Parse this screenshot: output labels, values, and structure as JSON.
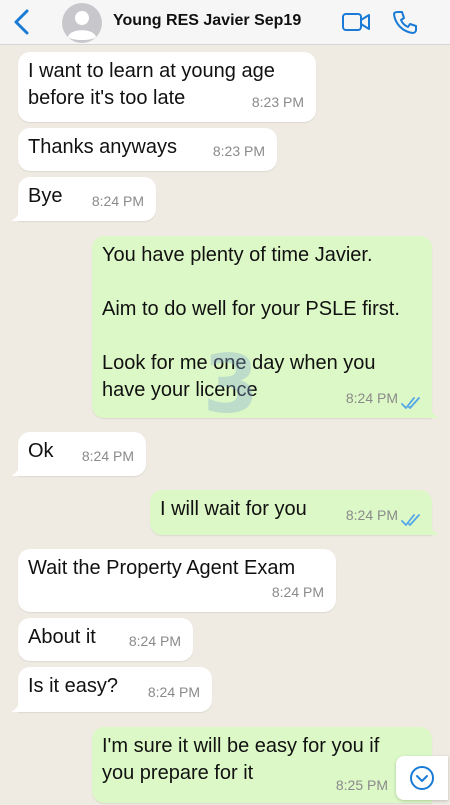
{
  "header": {
    "contact_name": "Young RES Javier Sep19",
    "icons": [
      "back-chevron",
      "avatar",
      "video-call",
      "phone-call"
    ]
  },
  "messages": [
    {
      "dir": "in",
      "text": "I want to learn at young age\nbefore it's too late",
      "time": "8:23 PM"
    },
    {
      "dir": "in",
      "text": "Thanks anyways",
      "time": "8:23 PM"
    },
    {
      "dir": "in",
      "text": "Bye",
      "time": "8:24 PM"
    },
    {
      "dir": "out",
      "text": "You have plenty of time Javier.\n\nAim to do well for your PSLE first.\n\nLook for me one day when you\nhave your licence",
      "time": "8:24 PM",
      "read": true
    },
    {
      "dir": "in",
      "text": "Ok",
      "time": "8:24 PM"
    },
    {
      "dir": "out",
      "text": "I will wait for you",
      "time": "8:24 PM",
      "read": true
    },
    {
      "dir": "in",
      "text": "Wait the Property Agent Exam",
      "time": "8:24 PM"
    },
    {
      "dir": "in",
      "text": "About it",
      "time": "8:24 PM"
    },
    {
      "dir": "in",
      "text": "Is it easy?",
      "time": "8:24 PM"
    },
    {
      "dir": "out",
      "text": "I'm sure it will be easy for you if\nyou prepare for it",
      "time": "8:25 PM"
    }
  ],
  "watermark": "3",
  "colors": {
    "accent": "#1a7bd6",
    "incoming_bubble": "#ffffff",
    "outgoing_bubble": "#dcf8c6",
    "read_ticks": "#53a6e8",
    "chat_background": "#efeae2"
  }
}
